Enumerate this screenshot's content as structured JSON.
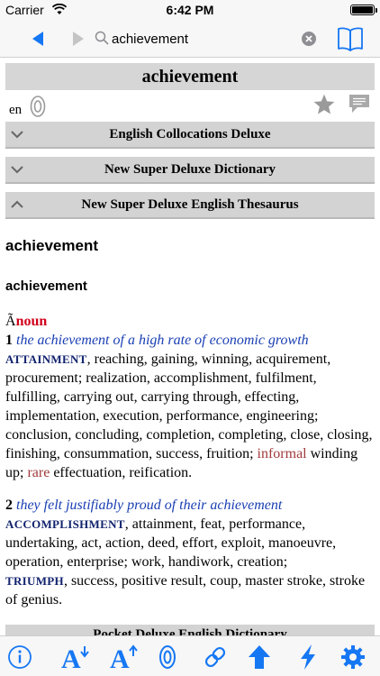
{
  "status": {
    "carrier": "Carrier",
    "time": "6:42 PM"
  },
  "search": {
    "value": "achievement",
    "placeholder": ""
  },
  "headword": "achievement",
  "language": "en",
  "sections": [
    {
      "title": "English Collocations Deluxe",
      "state": "collapsed"
    },
    {
      "title": "New Super Deluxe Dictionary",
      "state": "collapsed"
    },
    {
      "title": "New Super Deluxe English Thesaurus",
      "state": "expanded"
    }
  ],
  "entry": {
    "headword": "achievement",
    "subhead": "achievement",
    "pos_prefix": "Ã",
    "pos": "noun",
    "senses": [
      {
        "num": "1",
        "example": "the achievement of a high rate of economic growth",
        "headsyn": "ATTAINMENT",
        "text_a": ", reaching, gaining, winning, acquirement, procurement; realization, accomplishment, fulfilment, fulfilling, carrying out, carrying through, effecting, implementation, execution, performance, engineering; conclusion, concluding, completion, completing, close, closing, finishing, consummation, success, fruition; ",
        "label_informal": "informal",
        "text_b": " winding up; ",
        "label_rare": "rare",
        "text_c": " effectuation, reification."
      },
      {
        "num": "2",
        "example": "they felt justifiably proud of their achievement",
        "headsyn": "ACCOMPLISHMENT",
        "text_a": ", attainment, feat, performance, undertaking, act, action, deed, effort, exploit, manoeuvre, operation, enterprise; work, handiwork, creation;",
        "headsyn2": "TRIUMPH",
        "text_b": ", success, positive result, coup, master stroke, stroke of genius."
      }
    ]
  },
  "pocket_section": {
    "title": "Pocket Deluxe English Dictionary"
  },
  "toolbar": [
    "info-icon",
    "font-decrease-icon",
    "font-increase-icon",
    "audio-icon",
    "link-icon",
    "arrow-up-icon",
    "flash-icon",
    "settings-gear-icon"
  ],
  "colors": {
    "accent": "#1677f3",
    "pos_red": "#d0021b",
    "example_blue": "#1a3fb3",
    "label_red": "#a0393b",
    "bar_gray": "#d3d3d3"
  }
}
